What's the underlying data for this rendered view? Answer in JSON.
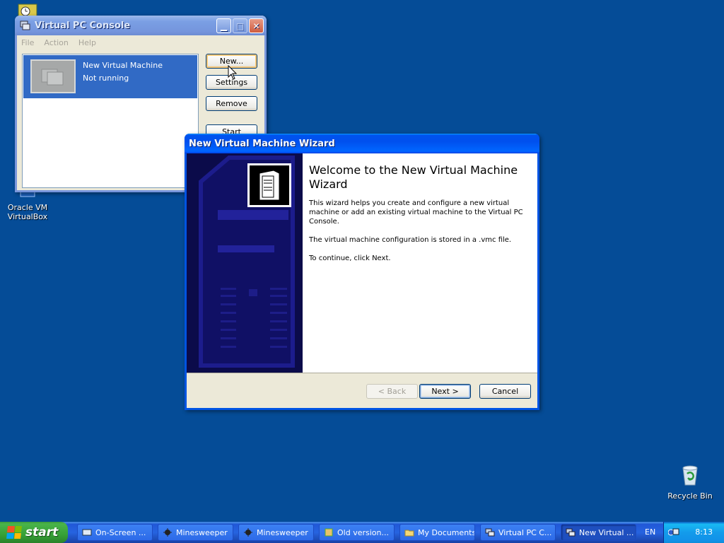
{
  "desktop": {
    "icons": [
      {
        "label_line1": "Oracle VM",
        "label_line2": "VirtualBox"
      },
      {
        "label_line1": "Recycle Bin",
        "label_line2": ""
      }
    ]
  },
  "vpc_console": {
    "title": "Virtual PC Console",
    "menu": [
      "File",
      "Action",
      "Help"
    ],
    "vm": {
      "name": "New Virtual Machine",
      "status": "Not running"
    },
    "buttons": {
      "new": "New...",
      "settings": "Settings",
      "remove": "Remove",
      "start": "Start"
    }
  },
  "wizard": {
    "title": "New Virtual Machine Wizard",
    "heading": "Welcome to the New Virtual Machine Wizard",
    "paragraphs": [
      "This wizard helps you create and configure a new virtual machine or add an existing virtual machine to the Virtual PC Console.",
      "The virtual machine configuration is stored in a .vmc file.",
      "To continue, click Next."
    ],
    "buttons": {
      "back": "< Back",
      "next": "Next >",
      "cancel": "Cancel"
    }
  },
  "taskbar": {
    "start_label": "start",
    "tasks": [
      {
        "label": "On-Screen ..."
      },
      {
        "label": "Minesweeper"
      },
      {
        "label": "Minesweeper"
      },
      {
        "label": "Old version..."
      },
      {
        "label": "My Documents"
      },
      {
        "label": "Virtual PC C..."
      },
      {
        "label": "New Virtual ..."
      }
    ],
    "language": "EN",
    "clock": "8:13"
  },
  "colors": {
    "desktop": "#054c97",
    "active_title": "#0053ee",
    "inactive_title": "#7a9fe4",
    "selection": "#316ac5",
    "wizard_sidebar": "#0b0b4a"
  }
}
